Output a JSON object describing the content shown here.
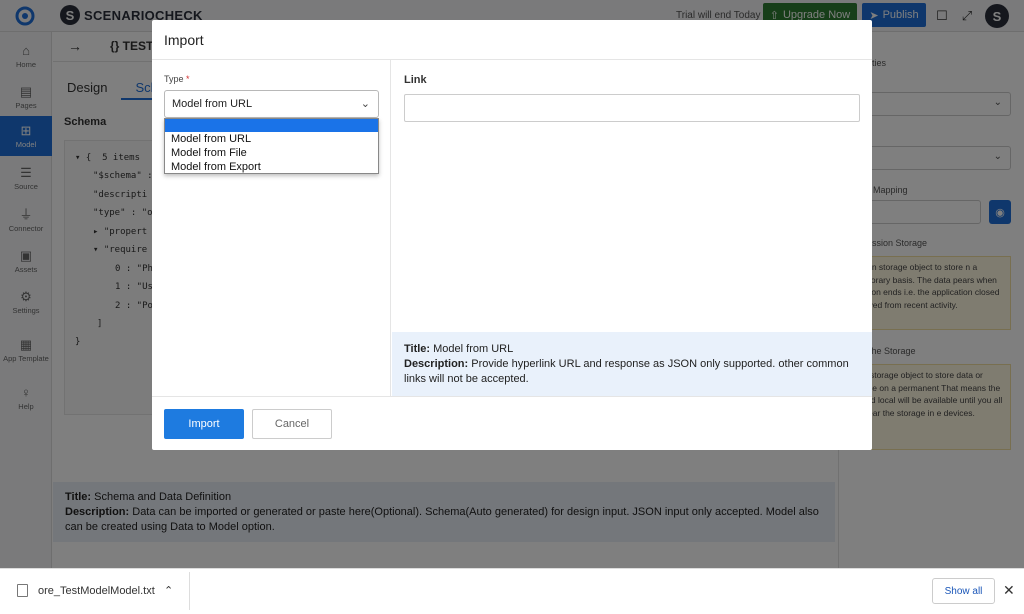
{
  "app": {
    "brand_letter": "S",
    "brand_name": "SCENARIOCHECK",
    "trial_text": "Trial will end Today",
    "upgrade_label": "Upgrade Now",
    "publish_label": "Publish",
    "avatar_letter": "S"
  },
  "nav": [
    {
      "label": "Home",
      "icon": "home-icon"
    },
    {
      "label": "Pages",
      "icon": "pages-icon"
    },
    {
      "label": "Model",
      "icon": "model-icon"
    },
    {
      "label": "Source",
      "icon": "database-icon"
    },
    {
      "label": "Connector",
      "icon": "plug-icon"
    },
    {
      "label": "Assets",
      "icon": "image-icon"
    },
    {
      "label": "Settings",
      "icon": "gear-icon"
    },
    {
      "label": "App Template",
      "icon": "template-icon"
    },
    {
      "label": "Help",
      "icon": "lightbulb-icon"
    }
  ],
  "main": {
    "breadcrumb": "{} TEST",
    "tabs": [
      "Design",
      "Sch"
    ],
    "schema_label": "Schema",
    "code_lines": [
      "▾ {  5 items",
      "\"$schema\" :",
      "\"descripti",
      "\"type\" : \"o",
      "▸ \"propert",
      "▾ \"require",
      "0 : \"Pho",
      "1 : \"Use",
      "2 : \"Po",
      "]",
      "}"
    ],
    "info_title_label": "Title:",
    "info_title": "Schema and Data Definition",
    "info_desc_label": "Description:",
    "info_desc": "Data can be imported or generated or paste here(Optional). Schema(Auto generated) for design input. JSON input only accepted. Model also can be created using Data to Model option."
  },
  "right_panel": {
    "tab": "ties",
    "select1": "ct",
    "select2": "e",
    "mapping_label": "Mapping",
    "session_label": "ession Storage",
    "session_note": "ession storage object to store n a temporary basis. The data pears when session ends i.e. the application closed and ved from recent activity.",
    "cache_label": "che Storage",
    "cache_note": "ocal storage object to store data or mobile on a permanent That means the stored local will be available until you all or clear the storage in e devices."
  },
  "modal": {
    "title": "Import",
    "type_label": "Type",
    "required_mark": "*",
    "type_selected": "Model from URL",
    "options": [
      "Model from URL",
      "Model from File",
      "Model from Export"
    ],
    "link_label": "Link",
    "link_value": "",
    "info_title_label": "Title:",
    "info_title": "Model from URL",
    "info_desc_label": "Description:",
    "info_desc": "Provide hyperlink URL and response as JSON only supported. other common links will not be accepted.",
    "import_label": "Import",
    "cancel_label": "Cancel"
  },
  "download": {
    "file_name": "ore_TestModelModel.txt",
    "show_all": "Show all"
  },
  "colors": {
    "accent": "#1e6fd9",
    "upgrade": "#2e7d32",
    "dropdown_highlight": "#1a73e8",
    "info_bg": "#e9f1fb"
  }
}
